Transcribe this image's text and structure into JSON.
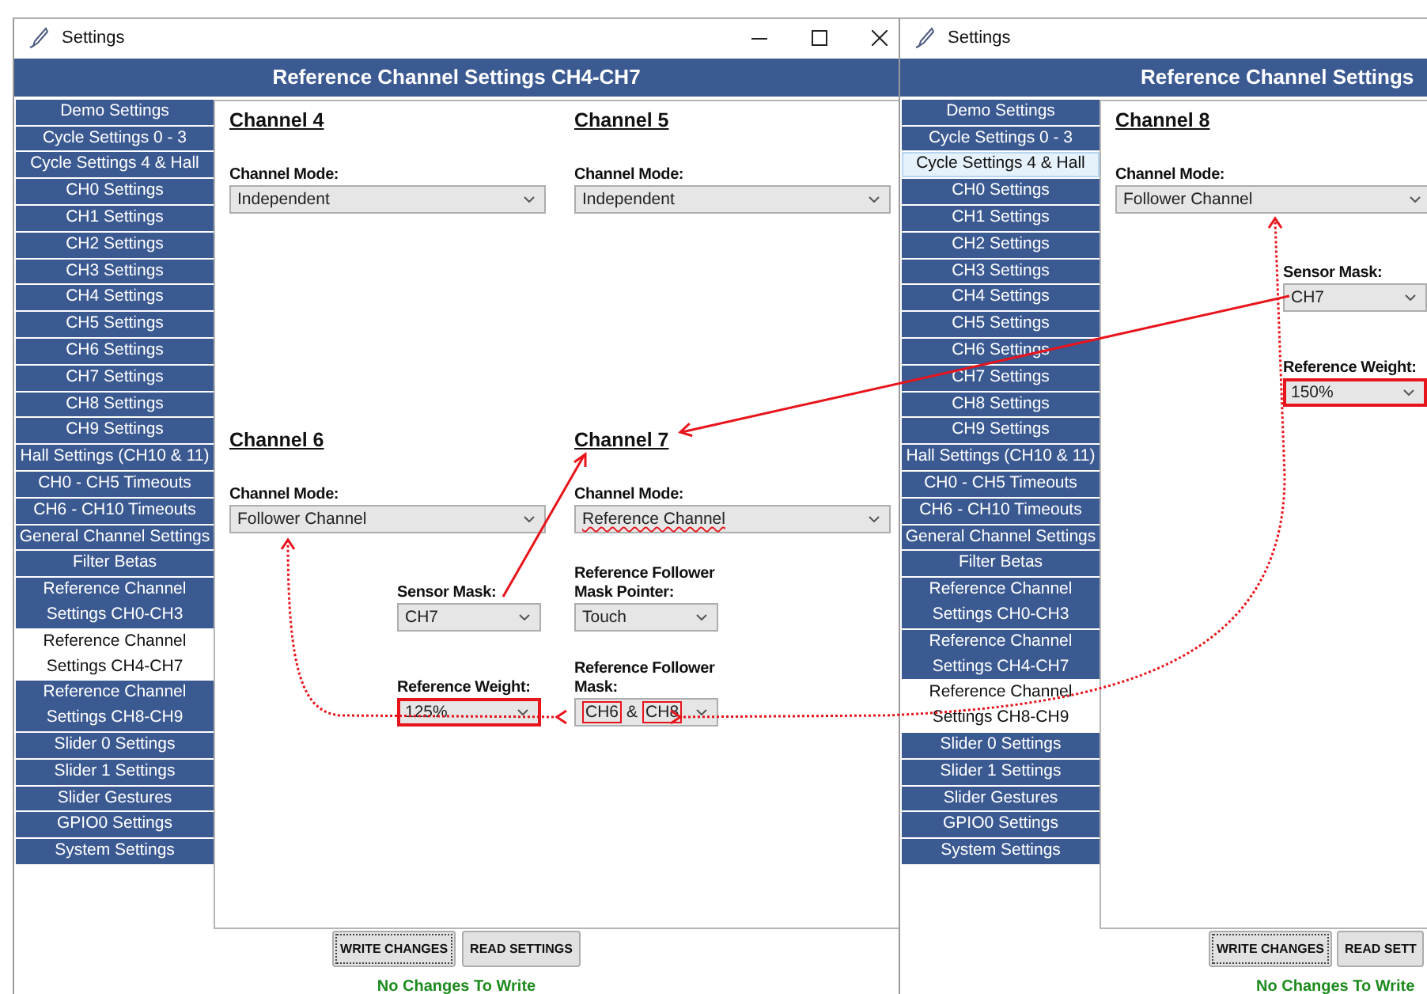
{
  "windows": [
    {
      "title": "Settings",
      "window_controls": [
        {
          "kind": "minimize"
        },
        {
          "kind": "maximize"
        },
        {
          "kind": "close"
        }
      ],
      "header": "Reference Channel Settings CH4-CH7",
      "sidebar": {
        "items": [
          {
            "label": "Demo Settings",
            "selected": false,
            "hovered": false
          },
          {
            "label": "Cycle Settings 0 - 3",
            "selected": false,
            "hovered": false
          },
          {
            "label": "Cycle Settings 4 & Hall",
            "selected": false,
            "hovered": false
          },
          {
            "label": "CH0 Settings",
            "selected": false,
            "hovered": false
          },
          {
            "label": "CH1 Settings",
            "selected": false,
            "hovered": false
          },
          {
            "label": "CH2 Settings",
            "selected": false,
            "hovered": false
          },
          {
            "label": "CH3 Settings",
            "selected": false,
            "hovered": false
          },
          {
            "label": "CH4 Settings",
            "selected": false,
            "hovered": false
          },
          {
            "label": "CH5 Settings",
            "selected": false,
            "hovered": false
          },
          {
            "label": "CH6 Settings",
            "selected": false,
            "hovered": false
          },
          {
            "label": "CH7 Settings",
            "selected": false,
            "hovered": false
          },
          {
            "label": "CH8 Settings",
            "selected": false,
            "hovered": false
          },
          {
            "label": "CH9 Settings",
            "selected": false,
            "hovered": false
          },
          {
            "label": "Hall Settings (CH10 & 11)",
            "selected": false,
            "hovered": false
          },
          {
            "label": "CH0 - CH5 Timeouts",
            "selected": false,
            "hovered": false
          },
          {
            "label": "CH6 - CH10 Timeouts",
            "selected": false,
            "hovered": false
          },
          {
            "label": "General Channel Settings",
            "selected": false,
            "hovered": false
          },
          {
            "label": "Filter Betas",
            "selected": false,
            "hovered": false
          },
          {
            "label": "Reference Channel Settings CH0-CH3",
            "selected": false,
            "hovered": false
          },
          {
            "label": "Reference Channel Settings CH4-CH7",
            "selected": true,
            "hovered": false
          },
          {
            "label": "Reference Channel Settings CH8-CH9",
            "selected": false,
            "hovered": false
          },
          {
            "label": "Slider 0 Settings",
            "selected": false,
            "hovered": false
          },
          {
            "label": "Slider 1 Settings",
            "selected": false,
            "hovered": false
          },
          {
            "label": "Slider Gestures",
            "selected": false,
            "hovered": false
          },
          {
            "label": "GPIO0 Settings",
            "selected": false,
            "hovered": false
          },
          {
            "label": "System Settings",
            "selected": false,
            "hovered": false
          }
        ]
      },
      "channels": [
        {
          "title": "Channel 4",
          "mode": {
            "label": "Channel Mode:",
            "value": "Independent",
            "highlighted": false,
            "spell_error": false
          }
        },
        {
          "title": "Channel 5",
          "mode": {
            "label": "Channel Mode:",
            "value": "Independent",
            "highlighted": false,
            "spell_error": false
          }
        },
        {
          "title": "Channel 6",
          "kind": "follower",
          "mode": {
            "label": "Channel Mode:",
            "value": "Follower Channel",
            "highlighted": false,
            "spell_error": false
          },
          "subfields": [
            {
              "label": "Sensor Mask:",
              "value": "CH7",
              "highlighted": false
            },
            {
              "label": "Reference Weight:",
              "value": "125%",
              "highlighted": true
            }
          ]
        },
        {
          "title": "Channel 7",
          "kind": "reference",
          "mode": {
            "label": "Channel Mode:",
            "value": "Reference Channel",
            "highlighted": false,
            "spell_error": true
          },
          "subfields": [
            {
              "label": "Reference Follower Mask Pointer:",
              "value": "Touch",
              "highlighted": false
            },
            {
              "label": "Reference Follower Mask:",
              "highlighted": false,
              "parts": [
                {
                  "text": "CH6",
                  "highlighted": true
                },
                {
                  "text": "&",
                  "highlighted": false
                },
                {
                  "text": "CH8",
                  "highlighted": true
                }
              ]
            }
          ]
        }
      ],
      "buttons": [
        {
          "label": "WRITE CHANGES",
          "focused": true
        },
        {
          "label": "READ SETTINGS",
          "focused": false
        }
      ],
      "status": "No Changes To Write"
    },
    {
      "title": "Settings",
      "header": "Reference Channel Settings",
      "sidebar": {
        "items": [
          {
            "label": "Demo Settings",
            "selected": false,
            "hovered": false
          },
          {
            "label": "Cycle Settings 0 - 3",
            "selected": false,
            "hovered": false
          },
          {
            "label": "Cycle Settings 4 & Hall",
            "selected": false,
            "hovered": true
          },
          {
            "label": "CH0 Settings",
            "selected": false,
            "hovered": false
          },
          {
            "label": "CH1 Settings",
            "selected": false,
            "hovered": false
          },
          {
            "label": "CH2 Settings",
            "selected": false,
            "hovered": false
          },
          {
            "label": "CH3 Settings",
            "selected": false,
            "hovered": false
          },
          {
            "label": "CH4 Settings",
            "selected": false,
            "hovered": false
          },
          {
            "label": "CH5 Settings",
            "selected": false,
            "hovered": false
          },
          {
            "label": "CH6 Settings",
            "selected": false,
            "hovered": false
          },
          {
            "label": "CH7 Settings",
            "selected": false,
            "hovered": false
          },
          {
            "label": "CH8 Settings",
            "selected": false,
            "hovered": false
          },
          {
            "label": "CH9 Settings",
            "selected": false,
            "hovered": false
          },
          {
            "label": "Hall Settings (CH10 & 11)",
            "selected": false,
            "hovered": false
          },
          {
            "label": "CH0 - CH5 Timeouts",
            "selected": false,
            "hovered": false
          },
          {
            "label": "CH6 - CH10 Timeouts",
            "selected": false,
            "hovered": false
          },
          {
            "label": "General Channel Settings",
            "selected": false,
            "hovered": false
          },
          {
            "label": "Filter Betas",
            "selected": false,
            "hovered": false
          },
          {
            "label": "Reference Channel Settings CH0-CH3",
            "selected": false,
            "hovered": false
          },
          {
            "label": "Reference Channel Settings CH4-CH7",
            "selected": false,
            "hovered": false
          },
          {
            "label": "Reference Channel Settings CH8-CH9",
            "selected": true,
            "hovered": false
          },
          {
            "label": "Slider 0 Settings",
            "selected": false,
            "hovered": false
          },
          {
            "label": "Slider 1 Settings",
            "selected": false,
            "hovered": false
          },
          {
            "label": "Slider Gestures",
            "selected": false,
            "hovered": false
          },
          {
            "label": "GPIO0 Settings",
            "selected": false,
            "hovered": false
          },
          {
            "label": "System Settings",
            "selected": false,
            "hovered": false
          }
        ]
      },
      "channels": [
        {
          "title": "Channel 8",
          "kind": "follower",
          "mode": {
            "label": "Channel Mode:",
            "value": "Follower Channel",
            "highlighted": false,
            "spell_error": false
          },
          "subfields": [
            {
              "label": "Sensor Mask:",
              "value": "CH7",
              "highlighted": false
            },
            {
              "label": "Reference Weight:",
              "value": "150%",
              "highlighted": true
            }
          ]
        }
      ],
      "buttons": [
        {
          "label": "WRITE CHANGES",
          "focused": true
        },
        {
          "label": "READ SETT",
          "focused": false
        }
      ],
      "status": "No Changes To Write"
    }
  ]
}
